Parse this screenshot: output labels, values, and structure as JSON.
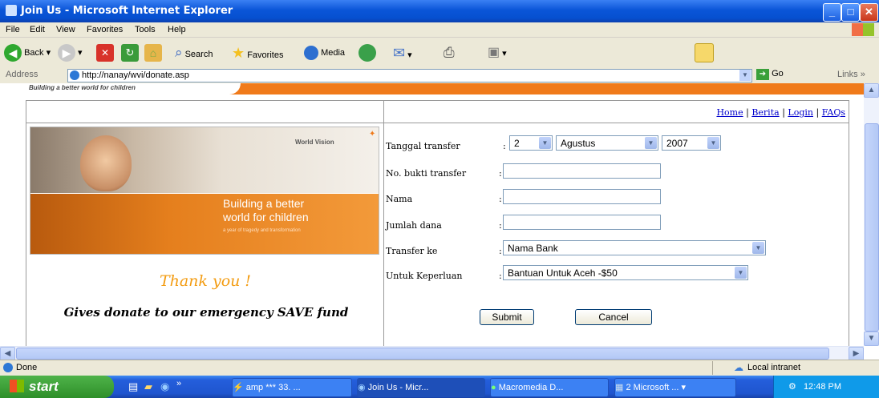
{
  "window": {
    "title": "Join Us - Microsoft Internet Explorer"
  },
  "menubar": {
    "items": [
      "File",
      "Edit",
      "View",
      "Favorites",
      "Tools",
      "Help"
    ]
  },
  "toolbar": {
    "back": "Back",
    "search": "Search",
    "favorites": "Favorites",
    "media": "Media"
  },
  "addressbar": {
    "label": "Address",
    "url": "http://nanay/wvi/donate.asp",
    "go": "Go",
    "links": "Links"
  },
  "page": {
    "banner_tagline": "Building a better world for children",
    "nav": {
      "home": "Home",
      "berita": "Berita",
      "login": "Login",
      "faqs": "FAQs",
      "sep": "|"
    },
    "photo": {
      "brand": "World Vision",
      "line1": "Building a better",
      "line2": "world for children",
      "line3": "a year of tragedy and transformation"
    },
    "thank_you": "Thank you !",
    "message": "Gives donate to our emergency SAVE fund",
    "form": {
      "tanggal_label": "Tanggal transfer",
      "day": "2",
      "month": "Agustus",
      "year": "2007",
      "bukti_label": "No. bukti transfer",
      "nama_label": "Nama",
      "jumlah_label": "Jumlah dana",
      "transfer_label": "Transfer ke",
      "transfer_value": "Nama Bank",
      "keperluan_label": "Untuk Keperluan",
      "keperluan_value": "Bantuan Untuk Aceh -$50",
      "colon": ":",
      "submit": "Submit",
      "cancel": "Cancel"
    }
  },
  "statusbar": {
    "status": "Done",
    "zone": "Local intranet"
  },
  "taskbar": {
    "start": "start",
    "tasks": [
      "amp *** 33. ...",
      "Join Us - Micr...",
      "Macromedia D...",
      "2 Microsoft ..."
    ],
    "clock": "12:48 PM"
  },
  "colors": {
    "titlebar": "#0a55d8",
    "banner_orange": "#f07a1a",
    "thank_you": "#f39c12"
  }
}
